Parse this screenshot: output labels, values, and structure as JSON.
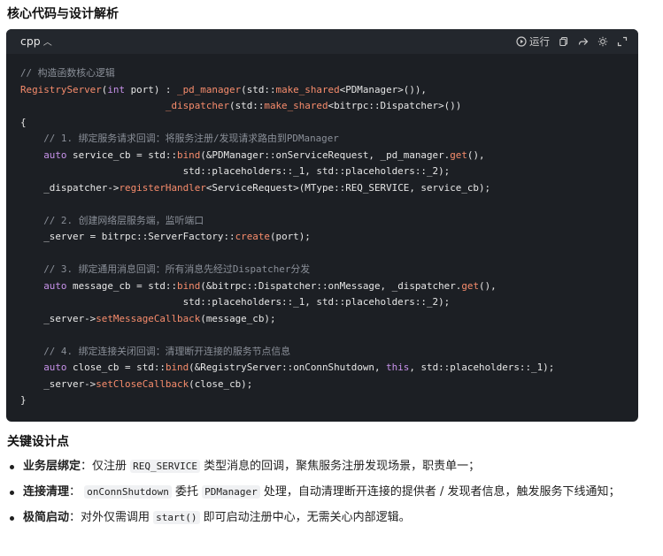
{
  "heading": "核心代码与设计解析",
  "code_block": {
    "language": "cpp",
    "language_icon": "chevron-up-icon",
    "run_label": "运行",
    "tools": [
      "play-icon",
      "copy-icon",
      "share-icon",
      "theme-icon",
      "expand-icon"
    ]
  },
  "code_lines": [
    [
      [
        "c",
        "// 构造函数核心逻辑"
      ]
    ],
    [
      [
        "f",
        "RegistryServer"
      ],
      [
        "t",
        "("
      ],
      [
        "k",
        "int"
      ],
      [
        "t",
        " port) : "
      ],
      [
        "f",
        "_pd_manager"
      ],
      [
        "t",
        "(std::"
      ],
      [
        "f",
        "make_shared"
      ],
      [
        "t",
        "<PDManager>()),"
      ]
    ],
    [
      [
        "t",
        "                         "
      ],
      [
        "f",
        "_dispatcher"
      ],
      [
        "t",
        "(std::"
      ],
      [
        "f",
        "make_shared"
      ],
      [
        "t",
        "<bitrpc::Dispatcher>())"
      ]
    ],
    [
      [
        "t",
        "{"
      ]
    ],
    [
      [
        "t",
        "    "
      ],
      [
        "c",
        "// 1. 绑定服务请求回调：将服务注册/发现请求路由到PDManager"
      ]
    ],
    [
      [
        "t",
        "    "
      ],
      [
        "k",
        "auto"
      ],
      [
        "t",
        " service_cb = std::"
      ],
      [
        "f",
        "bind"
      ],
      [
        "t",
        "(&PDManager::onServiceRequest, _pd_manager."
      ],
      [
        "f",
        "get"
      ],
      [
        "t",
        "(),"
      ]
    ],
    [
      [
        "t",
        "                            std::placeholders::_1, std::placeholders::_2);"
      ]
    ],
    [
      [
        "t",
        "    _dispatcher->"
      ],
      [
        "f",
        "registerHandler"
      ],
      [
        "t",
        "<ServiceRequest>(MType::REQ_SERVICE, service_cb);"
      ]
    ],
    [
      [
        "t",
        ""
      ]
    ],
    [
      [
        "t",
        "    "
      ],
      [
        "c",
        "// 2. 创建网络层服务端，监听端口"
      ]
    ],
    [
      [
        "t",
        "    _server = bitrpc::ServerFactory::"
      ],
      [
        "f",
        "create"
      ],
      [
        "t",
        "(port);"
      ]
    ],
    [
      [
        "t",
        ""
      ]
    ],
    [
      [
        "t",
        "    "
      ],
      [
        "c",
        "// 3. 绑定通用消息回调：所有消息先经过Dispatcher分发"
      ]
    ],
    [
      [
        "t",
        "    "
      ],
      [
        "k",
        "auto"
      ],
      [
        "t",
        " message_cb = std::"
      ],
      [
        "f",
        "bind"
      ],
      [
        "t",
        "(&bitrpc::Dispatcher::onMessage, _dispatcher."
      ],
      [
        "f",
        "get"
      ],
      [
        "t",
        "(),"
      ]
    ],
    [
      [
        "t",
        "                            std::placeholders::_1, std::placeholders::_2);"
      ]
    ],
    [
      [
        "t",
        "    _server->"
      ],
      [
        "f",
        "setMessageCallback"
      ],
      [
        "t",
        "(message_cb);"
      ]
    ],
    [
      [
        "t",
        ""
      ]
    ],
    [
      [
        "t",
        "    "
      ],
      [
        "c",
        "// 4. 绑定连接关闭回调：清理断开连接的服务节点信息"
      ]
    ],
    [
      [
        "t",
        "    "
      ],
      [
        "k",
        "auto"
      ],
      [
        "t",
        " close_cb = std::"
      ],
      [
        "f",
        "bind"
      ],
      [
        "t",
        "(&RegistryServer::onConnShutdown, "
      ],
      [
        "k",
        "this"
      ],
      [
        "t",
        ", std::placeholders::_1);"
      ]
    ],
    [
      [
        "t",
        "    _server->"
      ],
      [
        "f",
        "setCloseCallback"
      ],
      [
        "t",
        "(close_cb);"
      ]
    ],
    [
      [
        "t",
        "}"
      ]
    ]
  ],
  "design_heading": "关键设计点",
  "bullets": [
    {
      "title": "业务层绑定",
      "sep": "：仅注册 ",
      "code": "REQ_SERVICE",
      "rest": " 类型消息的回调，聚焦服务注册发现场景，职责单一；"
    },
    {
      "title": "连接清理",
      "sep": "： ",
      "code": "onConnShutdown",
      "mid": " 委托 ",
      "code2": "PDManager",
      "rest": " 处理，自动清理断开连接的提供者 / 发现者信息，触发服务下线通知；"
    },
    {
      "title": "极简启动",
      "sep": "：对外仅需调用 ",
      "code": "start()",
      "rest": " 即可启动注册中心，无需关心内部逻辑。"
    }
  ]
}
